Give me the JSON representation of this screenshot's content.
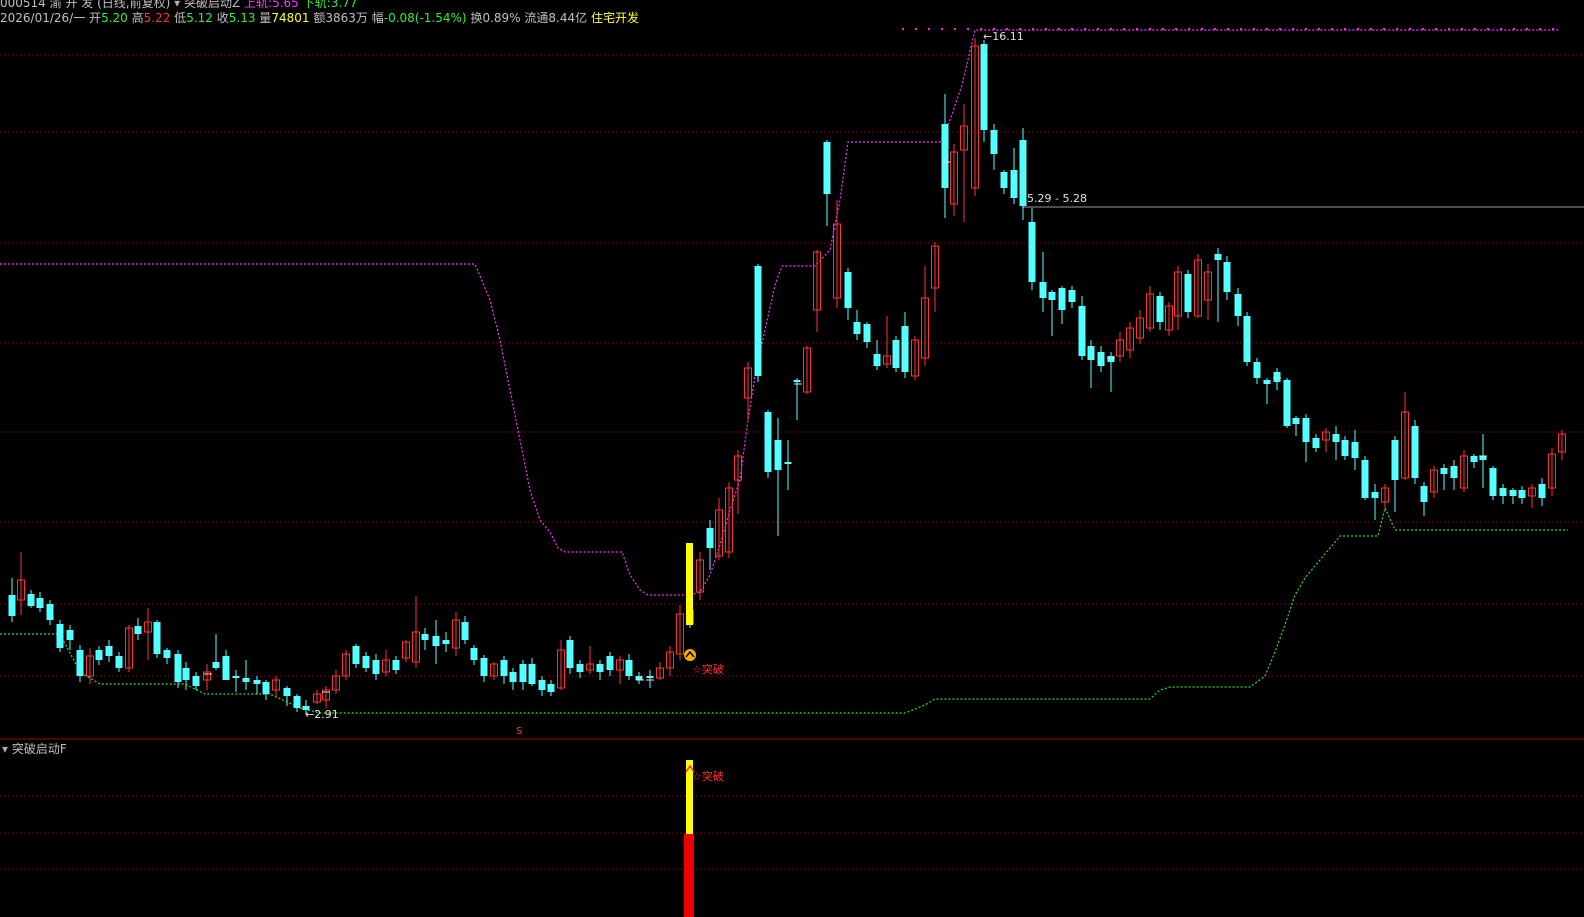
{
  "header": {
    "line1": {
      "code": "000514",
      "name": "渝 开 发",
      "mode": "(日线,前复权)",
      "indicator": "突破启动Z",
      "upper_label": "上轨:",
      "upper_value": "5.65",
      "lower_label": "下轨:",
      "lower_value": "3.77"
    },
    "line2": {
      "date": "2026/01/26/一",
      "open_label": "开",
      "open": "5.20",
      "high_label": "高",
      "high": "5.22",
      "low_label": "低",
      "low": "5.12",
      "close_label": "收",
      "close": "5.13",
      "vol_label": "量",
      "vol": "74801",
      "amt_label": "额",
      "amt": "3863万",
      "chg_label": "幅",
      "chg": "-0.08(-1.54%)",
      "turnover_label": "换",
      "turnover": "0.89%",
      "float_label": "流通",
      "float": "8.44亿",
      "sector": "住宅开发"
    }
  },
  "annotations": {
    "high_price": "16.11",
    "low_price": "2.91",
    "price_line": "5.29 - 5.28",
    "breakout_main": "突破",
    "breakout_sub": "突破",
    "marker_s": "S"
  },
  "sub_panel": {
    "title": "突破启动F"
  },
  "colors": {
    "up": "#ff3232",
    "down": "#54ffff",
    "upper_band": "#ff33ff",
    "lower_band": "#33dd33",
    "signal": "#ffff00",
    "grid": "#7a0000"
  }
}
